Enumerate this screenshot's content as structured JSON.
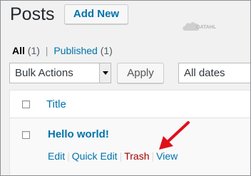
{
  "header": {
    "title": "Posts",
    "add_new_label": "Add New"
  },
  "watermark": {
    "text": "OATAHL"
  },
  "filters": {
    "all_label": "All",
    "all_count": "(1)",
    "separator": "|",
    "published_label": "Published",
    "published_count": "(1)"
  },
  "bulk_actions": {
    "selected": "Bulk Actions",
    "apply_label": "Apply"
  },
  "date_filter": {
    "selected": "All dates"
  },
  "table": {
    "columns": [
      "Title"
    ],
    "rows": [
      {
        "title": "Hello world!",
        "actions": {
          "edit": "Edit",
          "quick_edit": "Quick Edit",
          "trash": "Trash",
          "view": "View"
        }
      }
    ]
  },
  "colors": {
    "link": "#0073aa",
    "trash": "#a00000",
    "annotation_arrow": "#e0101a",
    "background": "#f1f1f1"
  },
  "icons": {
    "dropdown": "chevron-down-icon",
    "annotation": "arrow-pointer-icon",
    "watermark": "cloud-logo-icon"
  }
}
